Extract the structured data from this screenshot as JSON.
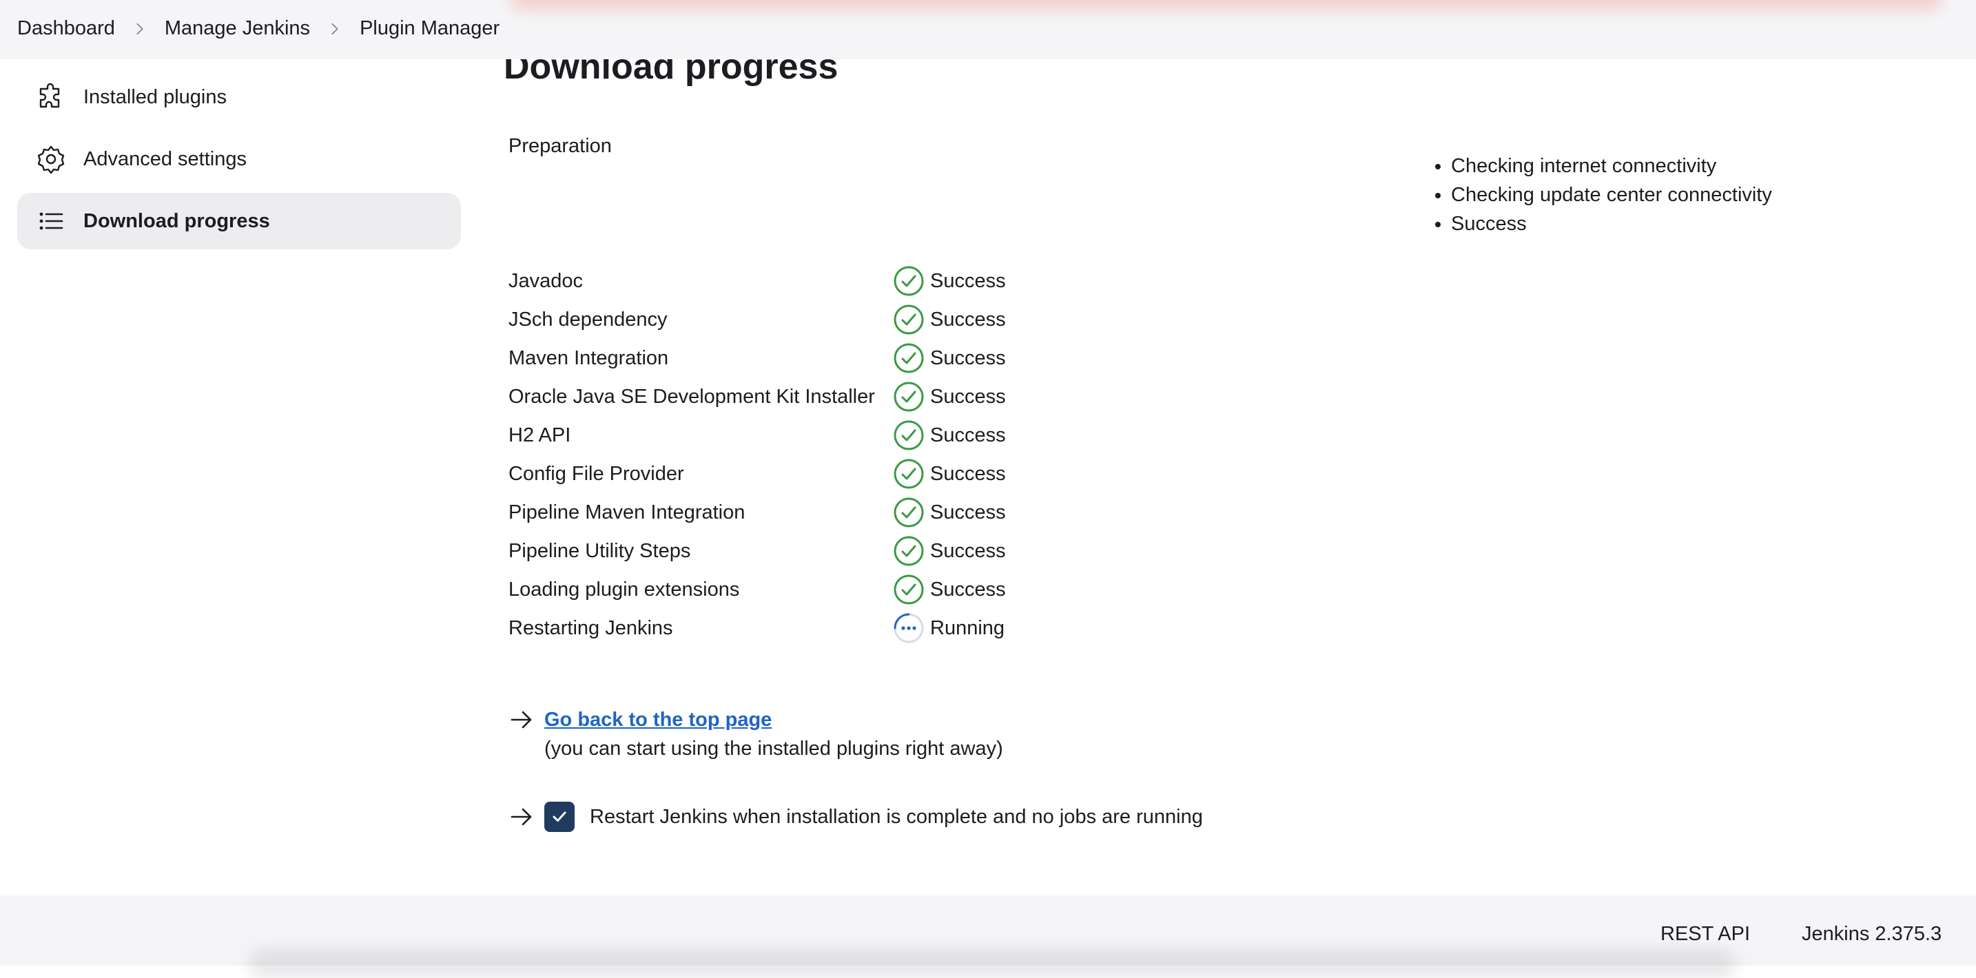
{
  "breadcrumb": {
    "items": [
      "Dashboard",
      "Manage Jenkins",
      "Plugin Manager"
    ]
  },
  "sidebar": {
    "items": [
      {
        "label": "Installed plugins",
        "icon": "puzzle-icon",
        "active": false
      },
      {
        "label": "Advanced settings",
        "icon": "gear-icon",
        "active": false
      },
      {
        "label": "Download progress",
        "icon": "list-icon",
        "active": true
      }
    ]
  },
  "main": {
    "title": "Download progress",
    "preparation": {
      "label": "Preparation",
      "steps": [
        "Checking internet connectivity",
        "Checking update center connectivity",
        "Success"
      ]
    },
    "plugins": [
      {
        "name": "Javadoc",
        "status": "Success",
        "icon": "check-circle-icon"
      },
      {
        "name": "JSch dependency",
        "status": "Success",
        "icon": "check-circle-icon"
      },
      {
        "name": "Maven Integration",
        "status": "Success",
        "icon": "check-circle-icon"
      },
      {
        "name": "Oracle Java SE Development Kit Installer",
        "status": "Success",
        "icon": "check-circle-icon"
      },
      {
        "name": "H2 API",
        "status": "Success",
        "icon": "check-circle-icon"
      },
      {
        "name": "Config File Provider",
        "status": "Success",
        "icon": "check-circle-icon"
      },
      {
        "name": "Pipeline Maven Integration",
        "status": "Success",
        "icon": "check-circle-icon"
      },
      {
        "name": "Pipeline Utility Steps",
        "status": "Success",
        "icon": "check-circle-icon"
      },
      {
        "name": "Loading plugin extensions",
        "status": "Success",
        "icon": "check-circle-icon"
      },
      {
        "name": "Restarting Jenkins",
        "status": "Running",
        "icon": "running-icon"
      }
    ],
    "back_link": {
      "label": "Go back to the top page",
      "note": "(you can start using the installed plugins right away)"
    },
    "restart": {
      "label": "Restart Jenkins when installation is complete and no jobs are running",
      "checked": true
    }
  },
  "footer": {
    "rest_api": "REST API",
    "version": "Jenkins 2.375.3"
  },
  "colors": {
    "success": "#3a9a44",
    "running": "#1f64c8",
    "link": "#1f64c8",
    "checkbox": "#1f3c5f",
    "sidebar_active": "#ededf0",
    "bar_background": "#f5f5f7"
  }
}
